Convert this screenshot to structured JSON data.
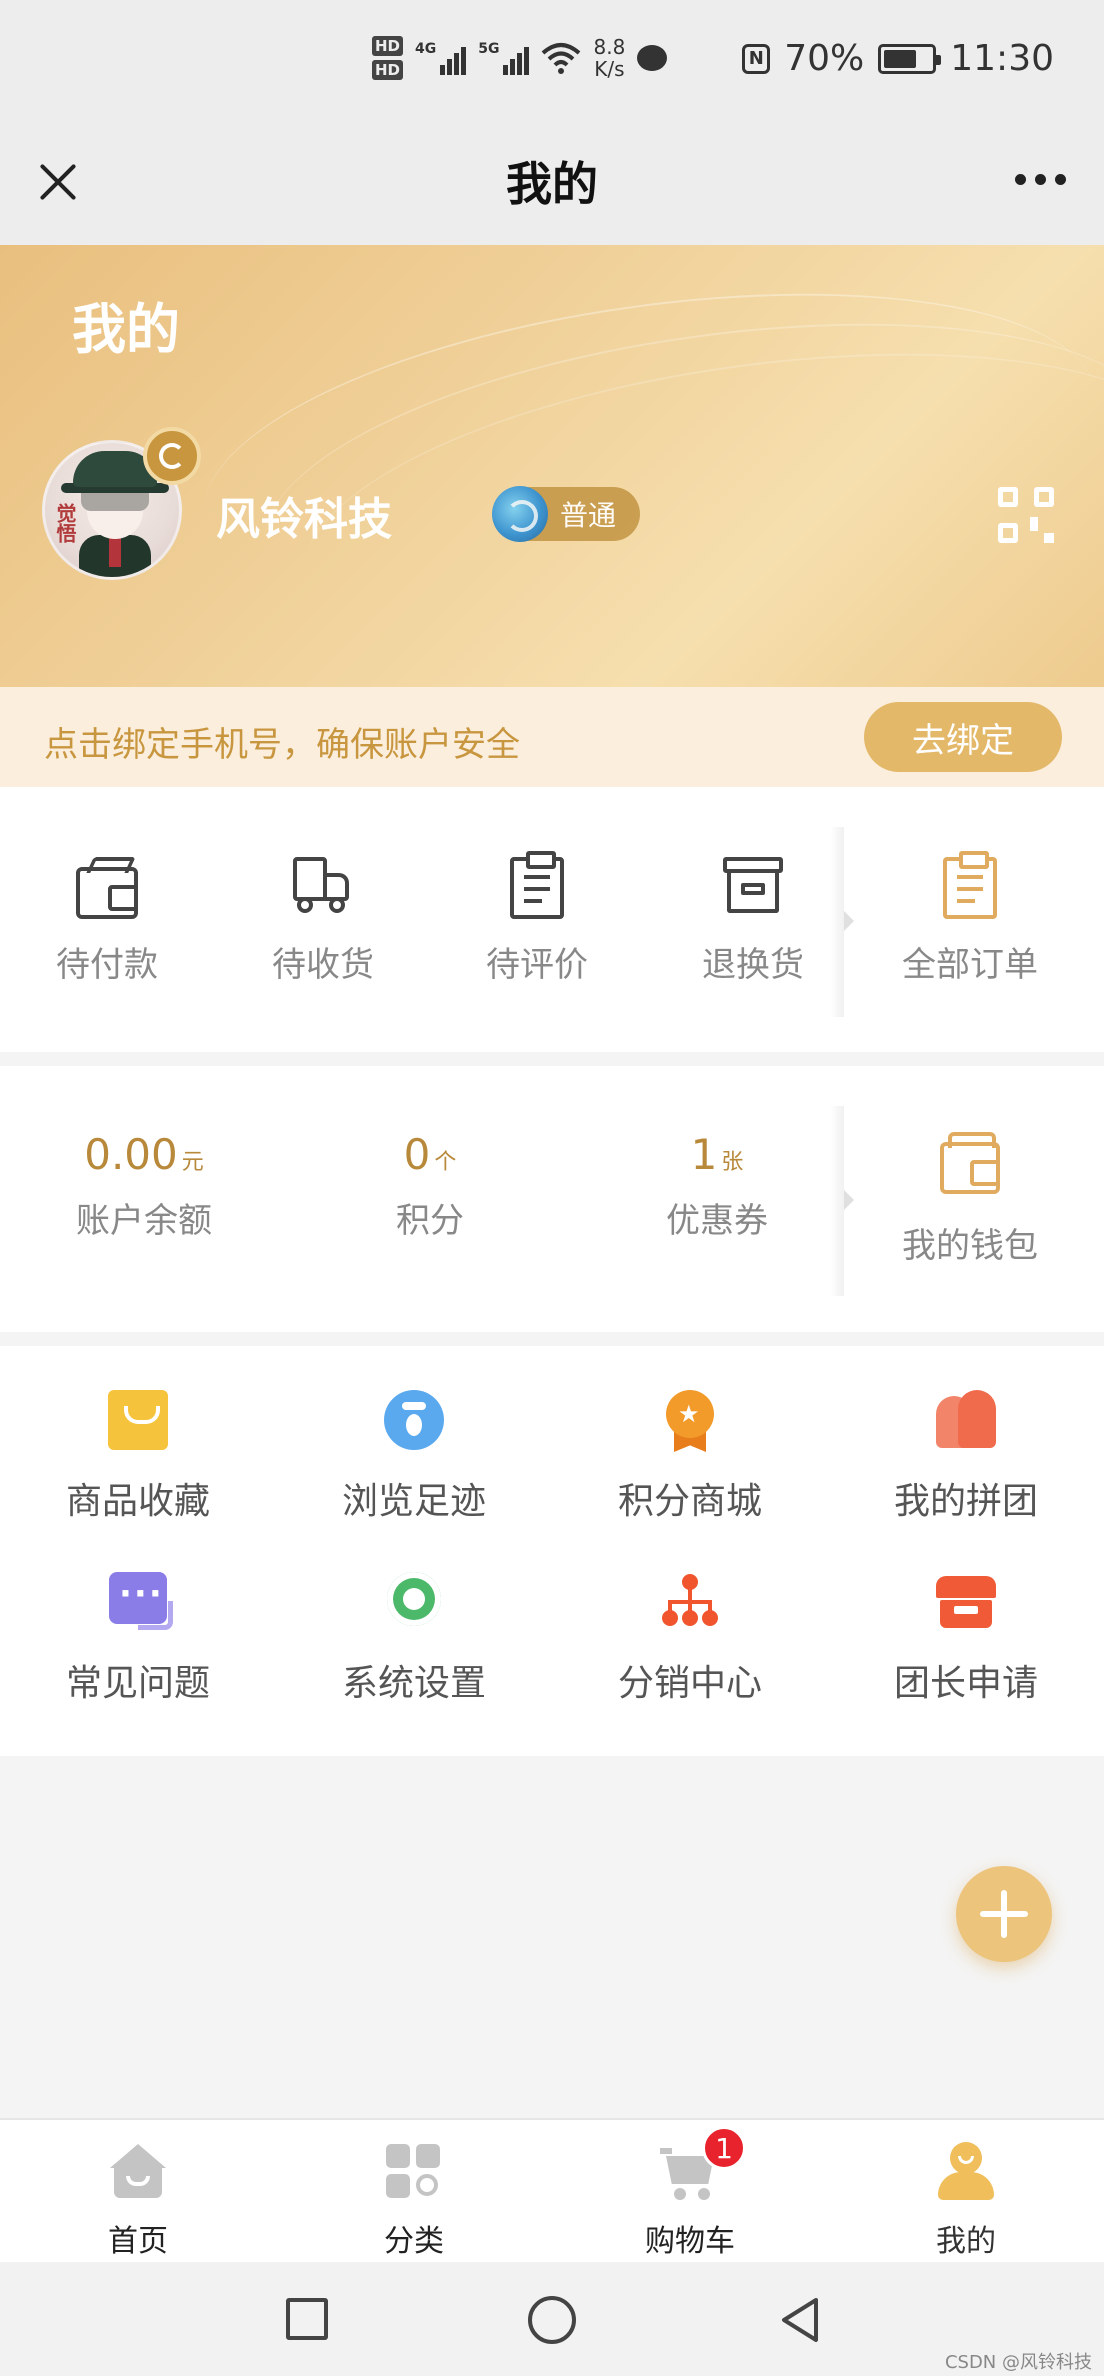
{
  "status_bar": {
    "hd1": "HD",
    "hd2": "HD",
    "net1": "4G",
    "net2": "5G",
    "speed_value": "8.8",
    "speed_unit": "K/s",
    "nfc": "N",
    "battery": "70%",
    "battery_level": 0.7,
    "time": "11:30"
  },
  "title_bar": {
    "title": "我的"
  },
  "hero": {
    "title": "我的",
    "username": "风铃科技",
    "level": "普通",
    "avatar_text": "觉悟"
  },
  "bind_bar": {
    "text": "点击绑定手机号，确保账户安全",
    "button": "去绑定"
  },
  "orders": [
    {
      "label": "待付款",
      "icon": "wallet-icon"
    },
    {
      "label": "待收货",
      "icon": "truck-icon"
    },
    {
      "label": "待评价",
      "icon": "clipboard-icon"
    },
    {
      "label": "退换货",
      "icon": "return-box-icon"
    },
    {
      "label": "全部订单",
      "icon": "all-orders-icon"
    }
  ],
  "wallet": {
    "stats": [
      {
        "value": "0.00",
        "unit": "元",
        "label": "账户余额"
      },
      {
        "value": "0",
        "unit": "个",
        "label": "积分"
      },
      {
        "value": "1",
        "unit": "张",
        "label": "优惠券"
      }
    ],
    "my_wallet": "我的钱包"
  },
  "tools": [
    {
      "label": "商品收藏",
      "icon": "shopping-bag-icon",
      "color": "#f6c43c"
    },
    {
      "label": "浏览足迹",
      "icon": "footprint-icon",
      "color": "#5aa9ee"
    },
    {
      "label": "积分商城",
      "icon": "medal-icon",
      "color": "#f29b2b"
    },
    {
      "label": "我的拼团",
      "icon": "group-icon",
      "color": "#f06a4c"
    },
    {
      "label": "常见问题",
      "icon": "chat-icon",
      "color": "#8b7de8"
    },
    {
      "label": "系统设置",
      "icon": "gear-icon",
      "color": "#4cb86a"
    },
    {
      "label": "分销中心",
      "icon": "hierarchy-icon",
      "color": "#f0552e"
    },
    {
      "label": "团长申请",
      "icon": "store-icon",
      "color": "#f05a36"
    }
  ],
  "tab_bar": {
    "items": [
      {
        "label": "首页",
        "icon": "home-icon"
      },
      {
        "label": "分类",
        "icon": "category-icon"
      },
      {
        "label": "购物车",
        "icon": "cart-icon",
        "badge": "1"
      },
      {
        "label": "我的",
        "icon": "profile-icon",
        "active": true
      }
    ]
  },
  "watermark": "CSDN @风铃科技",
  "colors": {
    "accent": "#e4b869",
    "gold_text": "#c8963e",
    "badge_red": "#e8232e"
  }
}
